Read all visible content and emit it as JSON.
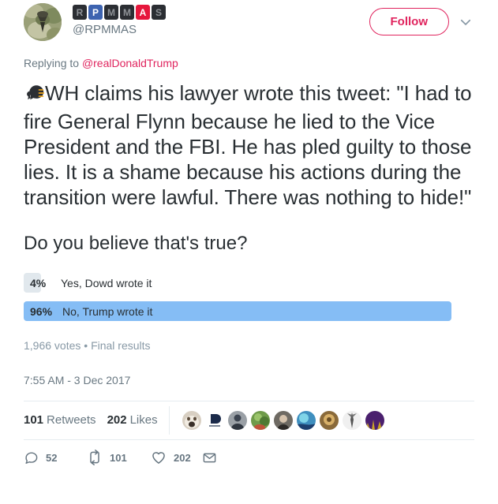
{
  "account": {
    "name_tiles": [
      {
        "letter": "R",
        "style": "dark"
      },
      {
        "letter": "P",
        "style": "blue"
      },
      {
        "letter": "M",
        "style": "dark"
      },
      {
        "letter": "M",
        "style": "dark"
      },
      {
        "letter": "A",
        "style": "red"
      },
      {
        "letter": "S",
        "style": "dark"
      }
    ],
    "handle": "@RPMMAS",
    "avatar_icon": "camouflage-avatar"
  },
  "header": {
    "follow_label": "Follow",
    "more_icon": "chevron-down-icon"
  },
  "reply_context": {
    "prefix": "Replying to ",
    "mention": "@realDonaldTrump"
  },
  "tweet": {
    "leading_emoji": "speaking-head-emoji",
    "text": "WH claims his lawyer wrote this tweet: \"I had to fire General Flynn because he lied to the Vice President and the FBI. He has pled guilty to those lies. It is a shame because his actions during the transition were lawful. There was nothing to hide!\""
  },
  "poll": {
    "question": "Do you believe that's true?",
    "options": [
      {
        "percent_label": "4%",
        "percent": 4,
        "text": "Yes, Dowd wrote it",
        "winner": false
      },
      {
        "percent_label": "96%",
        "percent": 96,
        "text": "No, Trump wrote it",
        "winner": true
      }
    ],
    "meta": "1,966 votes • Final results"
  },
  "timestamp": "7:55 AM - 3 Dec 2017",
  "stats": {
    "retweets_count": "101",
    "retweets_label": "Retweets",
    "likes_count": "202",
    "likes_label": "Likes",
    "facepile": [
      {
        "name": "avatar-dog",
        "c1": "#d8cfc2",
        "c2": "#5a4a3a"
      },
      {
        "name": "avatar-logo",
        "c1": "#ffffff",
        "c2": "#1b2a4a"
      },
      {
        "name": "avatar-portrait",
        "c1": "#9aa0a6",
        "c2": "#3c4450"
      },
      {
        "name": "avatar-green",
        "c1": "#6f9b4a",
        "c2": "#c0543a"
      },
      {
        "name": "avatar-person",
        "c1": "#6e6a63",
        "c2": "#2e2b28"
      },
      {
        "name": "avatar-blue",
        "c1": "#3f8fbf",
        "c2": "#1d3f6e"
      },
      {
        "name": "avatar-gold",
        "c1": "#8a6a3a",
        "c2": "#d8b068"
      },
      {
        "name": "avatar-tree",
        "c1": "#f0f0f0",
        "c2": "#555555"
      },
      {
        "name": "avatar-skyline",
        "c1": "#4a1f6e",
        "c2": "#c9a227"
      }
    ]
  },
  "actions": {
    "reply": {
      "icon": "reply-icon",
      "count": "52"
    },
    "retweet": {
      "icon": "retweet-icon",
      "count": "101"
    },
    "like": {
      "icon": "heart-icon",
      "count": "202"
    },
    "share": {
      "icon": "envelope-icon"
    }
  },
  "colors": {
    "accent": "#e0245e",
    "poll_winner_bar": "#85bdf5",
    "poll_loser_bar": "#e1e8ed",
    "text": "#292f33",
    "muted": "#697882"
  }
}
